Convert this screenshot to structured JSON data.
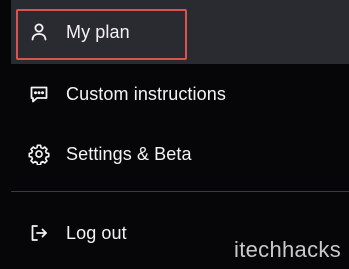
{
  "menu": {
    "items": [
      {
        "label": "My plan",
        "icon": "user-icon"
      },
      {
        "label": "Custom instructions",
        "icon": "chat-bubble-icon"
      },
      {
        "label": "Settings & Beta",
        "icon": "gear-icon"
      },
      {
        "label": "Log out",
        "icon": "logout-icon"
      }
    ]
  },
  "watermark": "itechhacks",
  "colors": {
    "background": "#060608",
    "selected_background": "#2a2b31",
    "highlight_border": "#d9534f",
    "text": "#f3f3f5"
  }
}
